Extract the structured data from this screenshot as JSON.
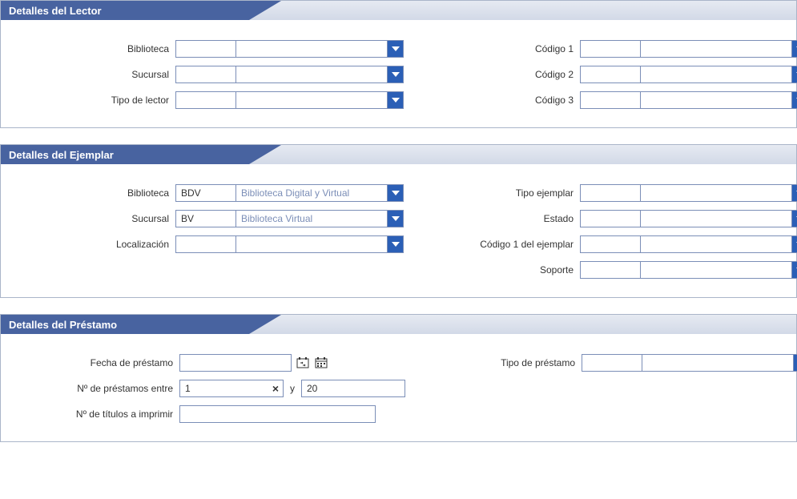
{
  "reader": {
    "title": "Detalles del Lector",
    "left": [
      {
        "label": "Biblioteca",
        "code": "",
        "desc": ""
      },
      {
        "label": "Sucursal",
        "code": "",
        "desc": ""
      },
      {
        "label": "Tipo de lector",
        "code": "",
        "desc": ""
      }
    ],
    "right": [
      {
        "label": "Código 1",
        "code": "",
        "desc": ""
      },
      {
        "label": "Código 2",
        "code": "",
        "desc": ""
      },
      {
        "label": "Código 3",
        "code": "",
        "desc": ""
      }
    ]
  },
  "item": {
    "title": "Detalles del Ejemplar",
    "left": [
      {
        "label": "Biblioteca",
        "code": "BDV",
        "desc": "Biblioteca Digital y Virtual"
      },
      {
        "label": "Sucursal",
        "code": "BV",
        "desc": "Biblioteca Virtual"
      },
      {
        "label": "Localización",
        "code": "",
        "desc": ""
      }
    ],
    "right": [
      {
        "label": "Tipo ejemplar",
        "code": "",
        "desc": ""
      },
      {
        "label": "Estado",
        "code": "",
        "desc": ""
      },
      {
        "label": "Código 1 del ejemplar",
        "code": "",
        "desc": ""
      },
      {
        "label": "Soporte",
        "code": "",
        "desc": ""
      }
    ]
  },
  "loan": {
    "title": "Detalles del Préstamo",
    "date_label": "Fecha de préstamo",
    "date_value": "",
    "between_label": "Nº de préstamos entre",
    "between_from": "1",
    "between_and": "y",
    "between_to": "20",
    "titles_label": "Nº de títulos a imprimir",
    "titles_value": "",
    "type_label": "Tipo de préstamo",
    "type_code": "",
    "type_desc": ""
  }
}
